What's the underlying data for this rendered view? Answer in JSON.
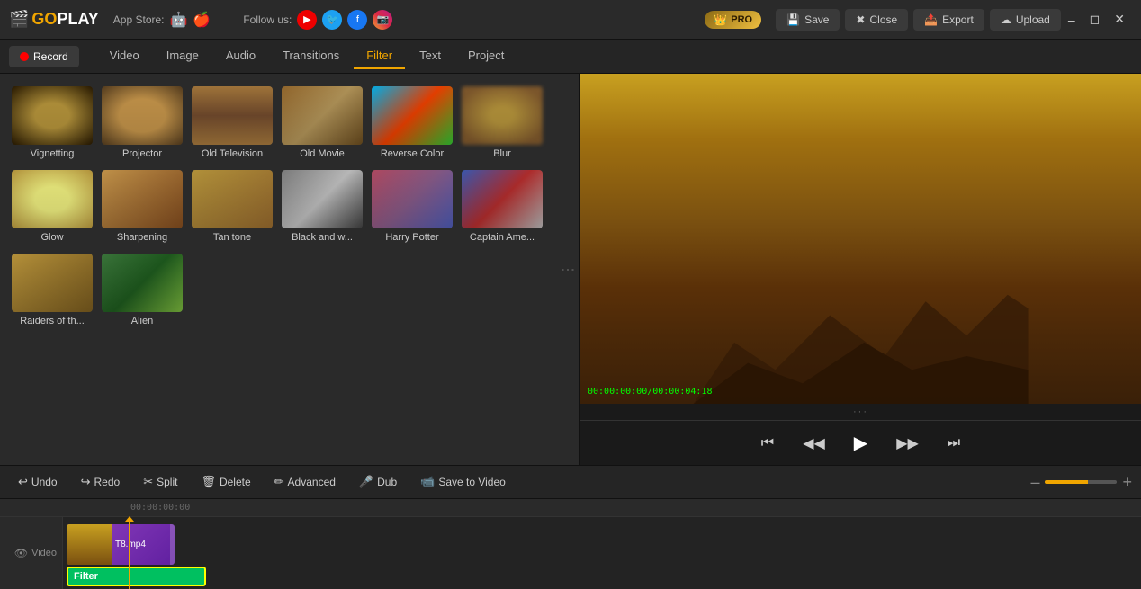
{
  "app": {
    "name": "GOPLAY",
    "pro_label": "PRO"
  },
  "topbar": {
    "appstore_label": "App Store:",
    "follow_label": "Follow us:",
    "save_label": "Save",
    "close_label": "Close",
    "export_label": "Export",
    "upload_label": "Upload",
    "win_minimize": "–",
    "win_restore": "◻",
    "win_close": "✕"
  },
  "toolbar2": {
    "record_label": "Record"
  },
  "nav_tabs": [
    {
      "label": "Video",
      "active": false
    },
    {
      "label": "Image",
      "active": false
    },
    {
      "label": "Audio",
      "active": false
    },
    {
      "label": "Transitions",
      "active": false
    },
    {
      "label": "Filter",
      "active": true
    },
    {
      "label": "Text",
      "active": false
    },
    {
      "label": "Project",
      "active": false
    }
  ],
  "filters": [
    {
      "id": "vignetting",
      "label": "Vignetting",
      "css_class": "ft-vignetting"
    },
    {
      "id": "projector",
      "label": "Projector",
      "css_class": "ft-projector"
    },
    {
      "id": "old-television",
      "label": "Old Television",
      "css_class": "ft-oldtv"
    },
    {
      "id": "old-movie",
      "label": "Old Movie",
      "css_class": "ft-oldmovie"
    },
    {
      "id": "reverse-color",
      "label": "Reverse Color",
      "css_class": "ft-reversecolor"
    },
    {
      "id": "blur",
      "label": "Blur",
      "css_class": "ft-blur"
    },
    {
      "id": "glow",
      "label": "Glow",
      "css_class": "ft-glow"
    },
    {
      "id": "sharpening",
      "label": "Sharpening",
      "css_class": "ft-sharpening"
    },
    {
      "id": "tan-tone",
      "label": "Tan tone",
      "css_class": "ft-tantone"
    },
    {
      "id": "black-and-white",
      "label": "Black and w...",
      "css_class": "ft-blackwhite"
    },
    {
      "id": "harry-potter",
      "label": "Harry Potter",
      "css_class": "ft-harrypotter"
    },
    {
      "id": "captain-america",
      "label": "Captain Ame...",
      "css_class": "ft-captainamerica"
    },
    {
      "id": "raiders",
      "label": "Raiders of th...",
      "css_class": "ft-raiders"
    },
    {
      "id": "alien",
      "label": "Alien",
      "css_class": "ft-alien"
    }
  ],
  "preview": {
    "timestamp": "00:00:00:00/00:00:04:18"
  },
  "controls": {
    "skip_start": "⏮",
    "prev_frame": "⏴",
    "play": "▶",
    "next_frame": "⏵",
    "skip_end": "⏭",
    "more_dots": "···"
  },
  "bottom_toolbar": {
    "undo_label": "Undo",
    "redo_label": "Redo",
    "split_label": "Split",
    "delete_label": "Delete",
    "advanced_label": "Advanced",
    "dub_label": "Dub",
    "save_to_video_label": "Save to Video"
  },
  "timeline": {
    "ruler_mark": "00:00:00:00",
    "track_label": "Video",
    "clip_filename": "T8.mp4",
    "filter_label": "Filter"
  }
}
